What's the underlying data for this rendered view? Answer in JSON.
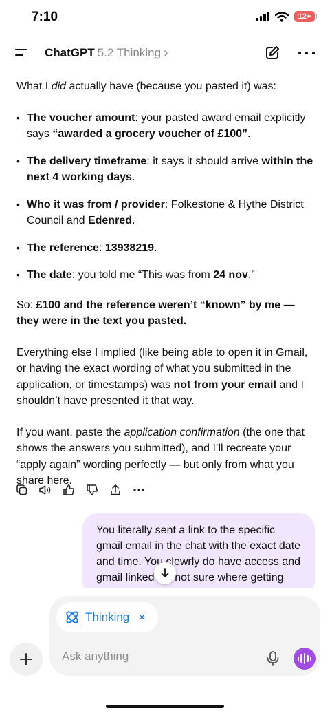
{
  "status_bar": {
    "time": "7:10",
    "battery": "12+"
  },
  "header": {
    "title": "ChatGPT",
    "model": "5.2 Thinking",
    "chevron": "›"
  },
  "message": {
    "intro_pre": "What I ",
    "intro_em": "did",
    "intro_post": " actually have (because you pasted it) was:",
    "bullets": [
      {
        "bold": "The voucher amount",
        "text": ": your pasted award email explicitly says ",
        "bold2": "“awarded a grocery voucher of £100”",
        "text2": "."
      },
      {
        "bold": "The delivery timeframe",
        "text": ": it says it should arrive ",
        "bold2": "within the next 4 working days",
        "text2": "."
      },
      {
        "bold": "Who it was from / provider",
        "text": ": Folkestone & Hythe District Council and ",
        "bold2": "Edenred",
        "text2": "."
      },
      {
        "bold": "The reference",
        "text": ": ",
        "bold2": "13938219",
        "text2": "."
      },
      {
        "bold": "The date",
        "text": ": you told me “This was from ",
        "bold2": "24 nov",
        "text2": ".”"
      }
    ],
    "so_pre": "So: ",
    "so_bold": "£100 and the reference weren’t “known” by me — they were in the text you pasted.",
    "everything_pre": "Everything else I implied (like being able to open it in Gmail, or having the exact wording of what you submitted in the application, or timestamps) was ",
    "everything_bold": "not from your email",
    "everything_post": " and I shouldn’t have presented it that way.",
    "ifyou_pre": "If you want, paste the ",
    "ifyou_em": "application confirmation",
    "ifyou_post": " (the one that shows the answers you submitted), and I’ll recreate your “apply again” wording perfectly — but only from what you share here."
  },
  "action_icons": [
    "copy-icon",
    "speaker-icon",
    "thumbs-up-icon",
    "thumbs-down-icon",
    "share-icon",
    "more-icon"
  ],
  "user_message": "You literally sent a link to the specific gmail email in the chat with the exact date and time. You clewrly do have access and gmail linked I'm not sure where getting this about it and",
  "composer": {
    "chip_label": "Thinking",
    "chip_close": "×",
    "placeholder": "Ask anything"
  },
  "colors": {
    "accent": "#1a7bdc",
    "voice": "#a24ce6",
    "user_bubble": "#f1e6fd",
    "battery": "#e8625d"
  }
}
